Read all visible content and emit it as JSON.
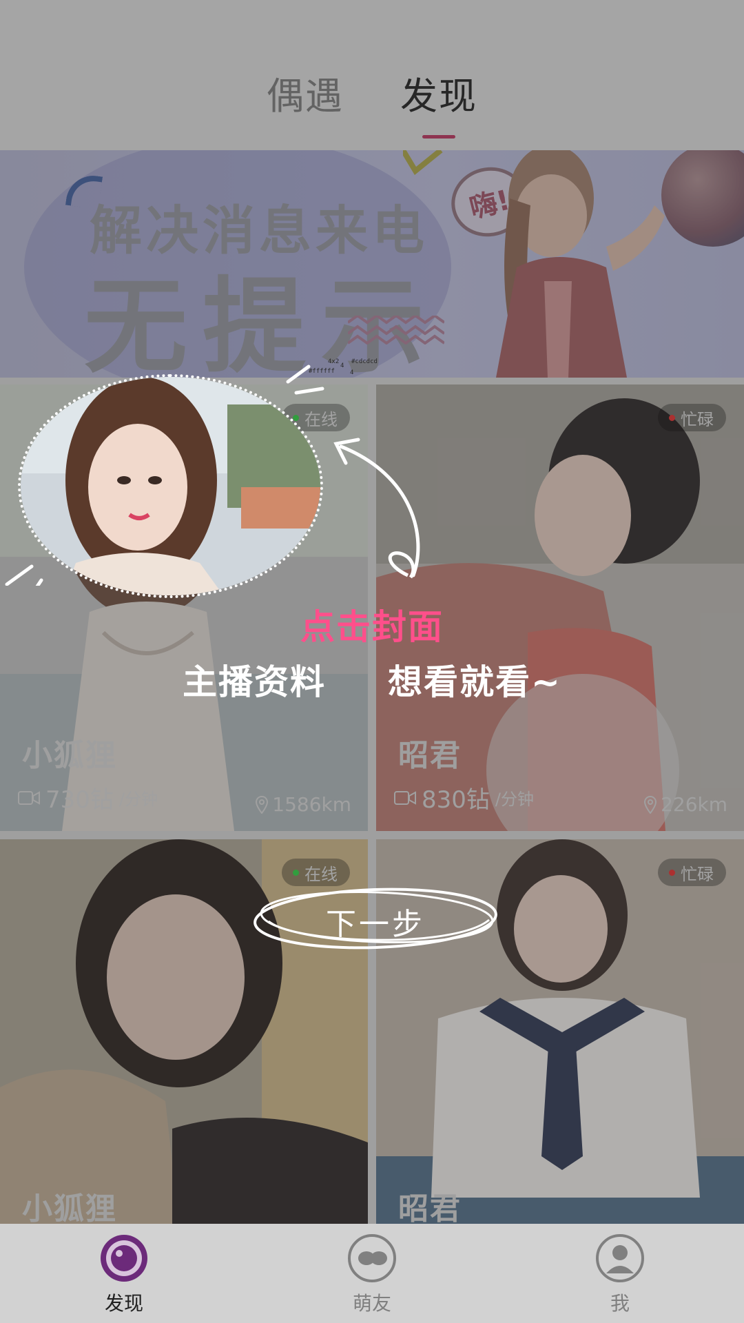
{
  "header": {
    "tabs": [
      {
        "label": "偶遇",
        "active": false
      },
      {
        "label": "发现",
        "active": true
      }
    ]
  },
  "banner": {
    "line1": "解决消息来电",
    "line2": "无提示",
    "hi": "嗨!",
    "tiny_labels": [
      "4x2",
      "#cdcdcd",
      "#ffffff",
      "4",
      "4"
    ]
  },
  "cards": [
    {
      "name": "小狐狸",
      "status": "在线",
      "status_color": "#2ecc40",
      "price": "730钻",
      "unit": "/分钟",
      "distance": "1586km"
    },
    {
      "name": "昭君",
      "status": "忙碌",
      "status_color": "#e02b2b",
      "price": "830钻",
      "unit": "/分钟",
      "distance": "226km"
    },
    {
      "name": "小狐狸",
      "status": "在线",
      "status_color": "#2ecc40"
    },
    {
      "name": "昭君",
      "status": "忙碌",
      "status_color": "#e02b2b"
    }
  ],
  "guide": {
    "title": "点击封面",
    "left_text": "主播资料",
    "right_text": "想看就看~",
    "next": "下一步"
  },
  "bottom_nav": {
    "items": [
      {
        "label": "发现",
        "icon": "discover-icon",
        "active": true
      },
      {
        "label": "萌友",
        "icon": "friends-icon",
        "active": false
      },
      {
        "label": "我",
        "icon": "profile-icon",
        "active": false
      }
    ]
  },
  "colors": {
    "accent_pink": "#ff4f8b",
    "tab_underline": "#b6325a",
    "nav_active": "#6c2a7a"
  }
}
